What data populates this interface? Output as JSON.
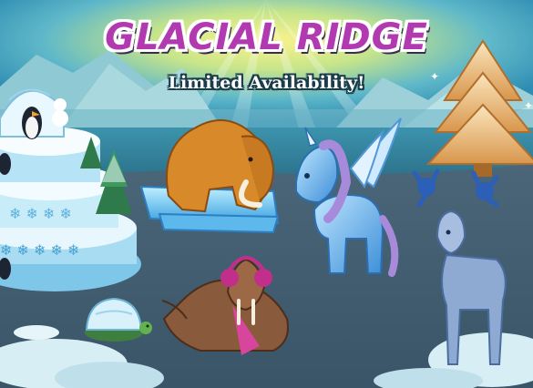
{
  "banner": {
    "title": "GLACIAL RIDGE",
    "subtitle": "Limited Availability!"
  },
  "colors": {
    "sky_top": "#3fa6c8",
    "sky_glow": "#f6f07a",
    "mountain": "#a9d9de",
    "water": "#3a8fa9",
    "ground": "#425e72",
    "title_purple": "#b23ab0",
    "mammoth": "#d88a2b",
    "ice": "#7fd3f7",
    "unicorn": "#69b6ea",
    "walrus": "#8a5a3c",
    "earmuffs": "#c22f8b",
    "gold_tree": "#e6b46a",
    "reindeer": "#7c98c5"
  },
  "items": [
    {
      "name": "Igloo Penguin Cake",
      "icon": "igloo-cake"
    },
    {
      "name": "Ice Mammoth",
      "icon": "mammoth"
    },
    {
      "name": "Ice Pegasus Unicorn",
      "icon": "pegasus"
    },
    {
      "name": "Golden Frost Tree",
      "icon": "golden-tree"
    },
    {
      "name": "Crystal Reindeer",
      "icon": "reindeer"
    },
    {
      "name": "Earmuff Walrus",
      "icon": "walrus"
    },
    {
      "name": "Igloo Turtle",
      "icon": "turtle"
    }
  ]
}
